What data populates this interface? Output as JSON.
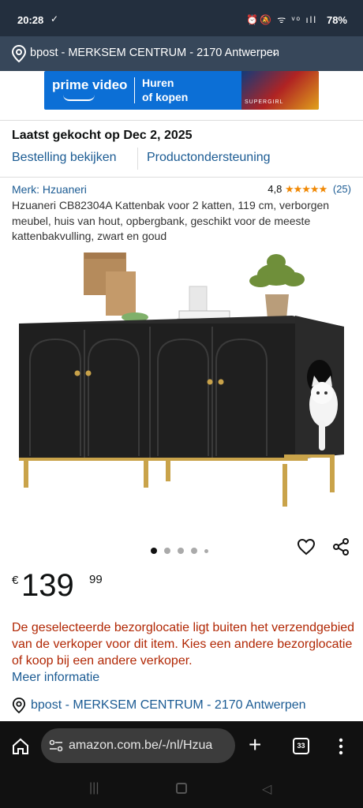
{
  "status_bar": {
    "time": "20:28",
    "check_glyph": "✓",
    "icons": "⏰🔕 ᯤ ᵛᵒ ıll",
    "battery": "78%"
  },
  "location_bar": {
    "text": "bpost - MERKSEM CENTRUM - 2170 Antwerpen",
    "chevron": "⌄"
  },
  "ad_banner": {
    "brand": "prime video",
    "line1": "Huren",
    "line2": "of kopen",
    "art_label": "SUPERGIRL"
  },
  "order": {
    "last_bought": "Laatst gekocht op Dec 2, 2025",
    "view_order": "Bestelling bekijken",
    "product_support": "Productondersteuning"
  },
  "product": {
    "brand": "Merk: Hzuaneri",
    "rating_value": "4,8",
    "stars": "★★★★★",
    "rating_count": "(25)",
    "title": "Hzuaneri CB82304A Kattenbak voor 2 katten, 119 cm, verborgen meubel, huis van hout, opbergbank, geschikt voor de meeste kattenbakvulling, zwart en goud",
    "image_count": 5,
    "active_image": 1
  },
  "price": {
    "currency": "€",
    "whole": "139",
    "fraction": "99"
  },
  "delivery": {
    "warning": "De geselecteerde bezorglocatie ligt buiten het verzendgebied van de verkoper voor dit item. Kies een andere bezorglocatie of koop bij een andere verkoper.",
    "more_info": "Meer informatie",
    "location": "bpost - MERKSEM CENTRUM - 2170 Antwerpen"
  },
  "browser": {
    "url": "amazon.com.be/-/nl/Hzua",
    "tab_count": "33",
    "new_tab": "+"
  },
  "nav": {
    "recents": "|||",
    "back": "◁"
  }
}
